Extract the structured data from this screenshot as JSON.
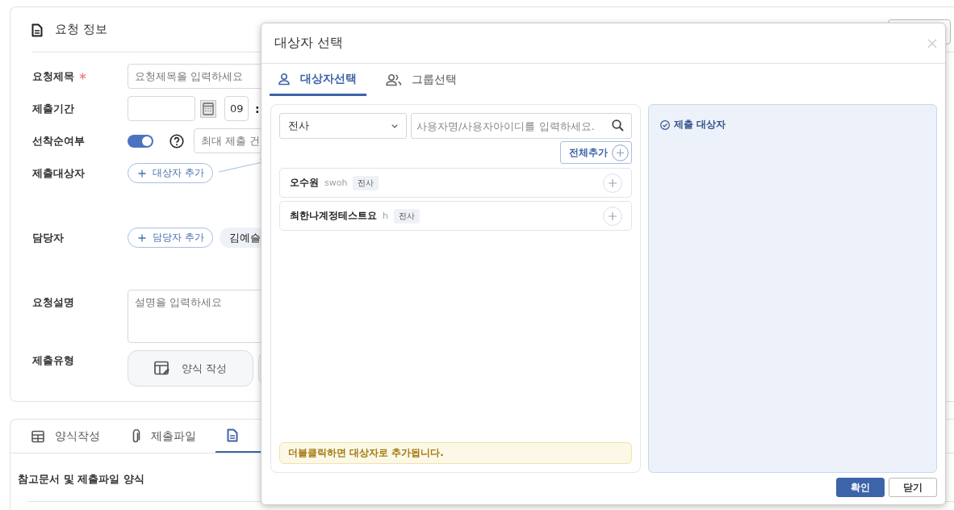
{
  "page": {
    "section_title": "요청 정보",
    "fields": [
      {
        "kind": "text",
        "label": "요청제목",
        "required": true,
        "placeholder": "요청제목을 입력하세요"
      },
      {
        "kind": "period",
        "label": "제출기간",
        "required": false,
        "hour": "09",
        "separator": ":"
      },
      {
        "kind": "toggle",
        "label": "선착순여부",
        "required": false,
        "on": true,
        "placeholder": "최대 제출 건"
      },
      {
        "kind": "add",
        "label": "제출대상자",
        "required": false,
        "button": "대상자 추가"
      },
      {
        "kind": "add",
        "label": "담당자",
        "required": false,
        "button": "담당자 추가",
        "chips": [
          "김예슬"
        ]
      },
      {
        "kind": "textarea",
        "label": "요청설명",
        "required": false,
        "placeholder": "설명을 입력하세요"
      },
      {
        "kind": "types",
        "label": "제출유형",
        "required": false,
        "options": [
          "양식 작성"
        ]
      }
    ],
    "bottom_tabs": [
      {
        "label": "양식작성",
        "selected": false
      },
      {
        "label": "제출파일",
        "selected": false
      },
      {
        "selected": true
      }
    ],
    "bottom_section_title": "참고문서 및 제출파일 양식"
  },
  "dialog": {
    "title": "대상자 선택",
    "tabs": [
      {
        "label": "대상자선택",
        "selected": true
      },
      {
        "label": "그룹선택",
        "selected": false
      }
    ],
    "scope_select": "전사",
    "search": {
      "placeholder": "사용자명/사용자아이디를 입력하세요."
    },
    "add_all_button": "전체추가",
    "users": [
      {
        "name": "오수원",
        "id": "swoh",
        "tag": "전사"
      },
      {
        "name": "최한나계정테스트요",
        "id": "h",
        "tag": "전사"
      }
    ],
    "hint": "더블클릭하면 대상자로 추가됩니다.",
    "selected_title": "제출 대상자",
    "buttons": [
      {
        "label": "확인",
        "kind": "primary"
      },
      {
        "label": "닫기",
        "kind": "secondary"
      }
    ]
  }
}
